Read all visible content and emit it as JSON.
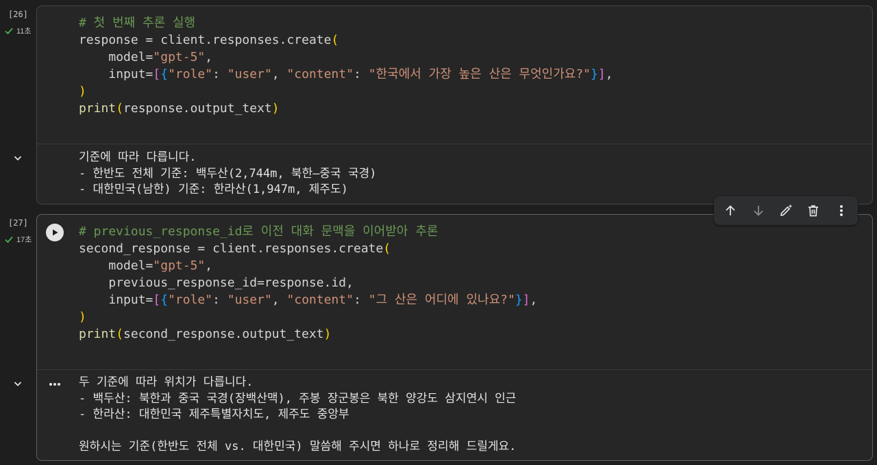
{
  "cells": [
    {
      "execution_count": "[26]",
      "status": "11초",
      "code": {
        "comment": "# 첫 번째 추론 실행",
        "var": "response",
        "call": "client.responses.create",
        "model_key": "model=",
        "model_value": "\"gpt-5\"",
        "input_key": "input=",
        "role_key": "\"role\"",
        "role_value": "\"user\"",
        "content_key": "\"content\"",
        "content_value": "\"한국에서 가장 높은 산은 무엇인가요?\"",
        "print_fn": "print",
        "print_arg": "response.output_text"
      },
      "output_lines": [
        "기준에 따라 다릅니다.",
        "- 한반도 전체 기준: 백두산(2,744m, 북한–중국 국경)",
        "- 대한민국(남한) 기준: 한라산(1,947m, 제주도)"
      ]
    },
    {
      "execution_count": "[27]",
      "status": "17초",
      "code": {
        "comment": "# previous_response_id로 이전 대화 문맥을 이어받아 추론",
        "var": "second_response",
        "call": "client.responses.create",
        "model_key": "model=",
        "model_value": "\"gpt-5\"",
        "prev_line": "previous_response_id=response.id,",
        "input_key": "input=",
        "role_key": "\"role\"",
        "role_value": "\"user\"",
        "content_key": "\"content\"",
        "content_value": "\"그 산은 어디에 있나요?\"",
        "print_fn": "print",
        "print_arg": "second_response.output_text"
      },
      "output_lines": [
        "두 기준에 따라 위치가 다릅니다.",
        "- 백두산: 북한과 중국 국경(장백산맥), 주봉 장군봉은 북한 양강도 삼지연시 인근",
        "- 한라산: 대한민국 제주특별자치도, 제주도 중앙부",
        "",
        "원하시는 기준(한반도 전체 vs. 대한민국) 말씀해 주시면 하나로 정리해 드릴게요."
      ]
    }
  ],
  "toolbar": {
    "icons": [
      "arrow-up-icon",
      "arrow-down-icon",
      "edit-sparkle-icon",
      "trash-icon",
      "more-vert-icon"
    ]
  },
  "colors": {
    "background": "#1e1e1e",
    "cell_background": "#262626",
    "comment": "#6a9955",
    "string": "#ce9178",
    "bracket_level1": "#ffd700",
    "bracket_level2": "#da70d6",
    "bracket_level3": "#179fff",
    "success_check": "#4caf50"
  }
}
